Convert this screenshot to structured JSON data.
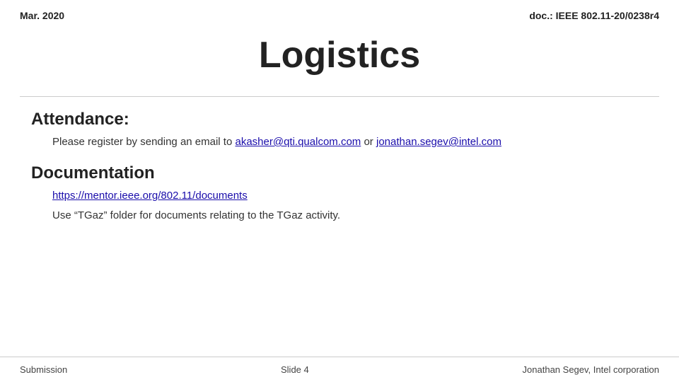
{
  "header": {
    "left": "Mar. 2020",
    "right": "doc.: IEEE 802.11-20/0238r4"
  },
  "title": "Logistics",
  "sections": [
    {
      "id": "attendance",
      "heading": "Attendance:",
      "body_text": "Please register by sending an email to ",
      "link1": "akasher@qti.qualcom.com",
      "link1_href": "mailto:akasher@qti.qualcom.com",
      "connector": " or ",
      "link2": "jonathan.segev@intel.com",
      "link2_href": "mailto:jonathan.segev@intel.com"
    },
    {
      "id": "documentation",
      "heading": "Documentation",
      "link": "https://mentor.ieee.org/802.11/documents",
      "body_text": "Use “TGaz” folder for documents relating to the TGaz activity."
    }
  ],
  "footer": {
    "left": "Submission",
    "center": "Slide 4",
    "right": "Jonathan Segev, Intel corporation"
  }
}
